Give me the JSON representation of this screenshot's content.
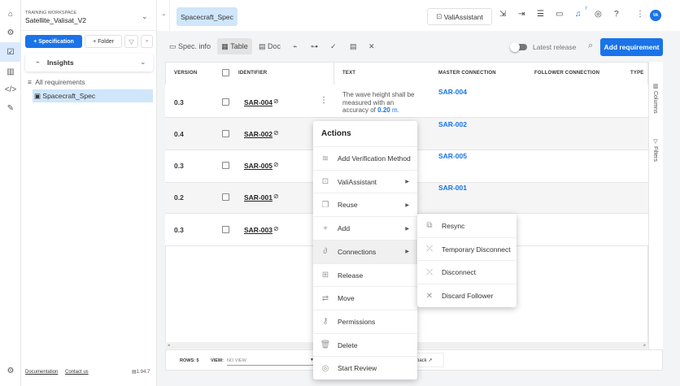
{
  "sidebar": {
    "workspace_label": "TRAINING WORKSPACE",
    "workspace_name": "Satellite_Valisat_V2",
    "specification_button": "+ Specification",
    "folder_button": "+ Folder",
    "insights": "Insights",
    "all_requirements": "All requirements",
    "spec_item": "Spacecraft_Spec",
    "documentation": "Documentation",
    "contact": "Contact us",
    "version": "1.94.7"
  },
  "topbar": {
    "tab": "Spacecraft_Spec",
    "valiassistant": "ValiAssistant",
    "notification_count": "7",
    "avatar": "VA"
  },
  "toolbar": {
    "spec_info": "Spec. info",
    "table": "Table",
    "doc": "Doc",
    "latest_release": "Latest release",
    "add_requirement": "Add requirement",
    "latest_release_on": false
  },
  "table": {
    "headers": [
      "VERSION",
      "IDENTIFIER",
      "TEXT",
      "MASTER CONNECTION",
      "FOLLOWER CONNECTION",
      "TYPE"
    ],
    "rows": [
      {
        "version": "0.3",
        "id": "SAR-004",
        "text_pre": "The wave height shall be measured with an accuracy of ",
        "text_val": "0.20",
        "text_unit": " m.",
        "master": "SAR-004"
      },
      {
        "version": "0.4",
        "id": "SAR-002",
        "master": "SAR-002"
      },
      {
        "version": "0.3",
        "id": "SAR-005",
        "master": "SAR-005"
      },
      {
        "version": "0.2",
        "id": "SAR-001",
        "master": "SAR-001"
      },
      {
        "version": "0.3",
        "id": "SAR-003",
        "master": ""
      }
    ]
  },
  "side_panel": {
    "columns": "Columns",
    "filters": "Filters"
  },
  "footer": {
    "rows_label": "ROWS:",
    "rows_value": "5",
    "view_label": "VIEW:",
    "view_value": "NO VIEW",
    "feedback": "back"
  },
  "menu": {
    "title": "Actions",
    "items": [
      {
        "label": "Add Verification Method",
        "icon": "layers-plus-icon",
        "sub": false
      },
      {
        "label": "ValiAssistant",
        "icon": "robot-icon",
        "sub": true
      },
      {
        "label": "Reuse",
        "icon": "copy-icon",
        "sub": true
      },
      {
        "label": "Add",
        "icon": "plus-icon",
        "sub": true
      },
      {
        "label": "Connections",
        "icon": "link-icon",
        "sub": true
      },
      {
        "label": "Release",
        "icon": "release-icon",
        "sub": false
      },
      {
        "label": "Move",
        "icon": "move-icon",
        "sub": false
      },
      {
        "label": "Permissions",
        "icon": "key-icon",
        "sub": false
      },
      {
        "label": "Delete",
        "icon": "trash-icon",
        "sub": false
      },
      {
        "label": "Start Review",
        "icon": "review-check-icon",
        "sub": false
      }
    ]
  },
  "submenu": {
    "items": [
      {
        "label": "Resync",
        "icon": "resync-icon"
      },
      {
        "label": "Temporary Disconnect",
        "icon": "disconnect-icon"
      },
      {
        "label": "Disconnect",
        "icon": "disconnect-icon"
      },
      {
        "label": "Discard Follower",
        "icon": "x-icon"
      }
    ]
  }
}
